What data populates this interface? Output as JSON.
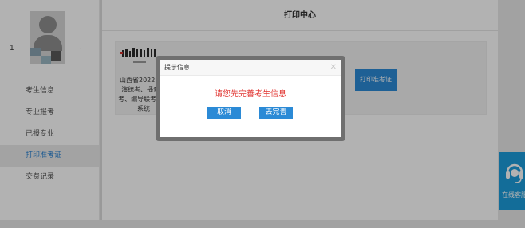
{
  "sidebar": {
    "username": "1",
    "items": [
      {
        "label": "考生信息",
        "active": false
      },
      {
        "label": "专业报考",
        "active": false
      },
      {
        "label": "已报专业",
        "active": false
      },
      {
        "label": "打印准考证",
        "active": true
      },
      {
        "label": "交费记录",
        "active": false
      }
    ]
  },
  "main": {
    "title": "打印中心",
    "card": {
      "description": "山西省2022年...演统考、播音...考、编导联考...名系统",
      "print_button": "打印准考证"
    }
  },
  "dialog": {
    "title": "提示信息",
    "message": "请您先完善考生信息",
    "cancel_label": "取消",
    "complete_label": "去完善",
    "close_icon": "close-icon"
  },
  "customer_service": {
    "label": "在线客服",
    "icon": "headset-icon",
    "color": "#1c9ddc"
  },
  "colors": {
    "accent": "#2b8ad6",
    "active_nav": "#2b83d1",
    "alert_text": "#e0332f"
  }
}
